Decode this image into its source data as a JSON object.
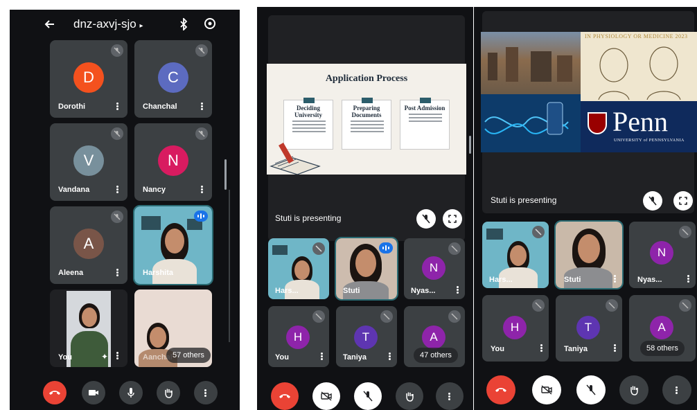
{
  "meeting": {
    "code": "dnz-axvj-sjo",
    "code_caret": "▸"
  },
  "colors": {
    "orange": "#f4511e",
    "indigo": "#5c6bc0",
    "slate": "#78909c",
    "crimson": "#d81b60",
    "brown": "#795548",
    "purple": "#8e24aa",
    "hangup": "#ea4335"
  },
  "screen1": {
    "tiles": [
      {
        "initial": "D",
        "name": "Dorothi"
      },
      {
        "initial": "C",
        "name": "Chanchal"
      },
      {
        "initial": "V",
        "name": "Vandana"
      },
      {
        "initial": "N",
        "name": "Nancy"
      },
      {
        "initial": "A",
        "name": "Aleena"
      },
      {
        "name": "Harshita"
      },
      {
        "name": "You"
      },
      {
        "name": "Aanchal"
      }
    ],
    "others": "57 others"
  },
  "screen2": {
    "presenting": "Stuti is presenting",
    "slide": {
      "title": "Application Process",
      "cards": [
        "Deciding University",
        "Preparing Documents",
        "Post Admission"
      ]
    },
    "tiles": [
      {
        "name": "Hars..."
      },
      {
        "name": "Stuti"
      },
      {
        "initial": "N",
        "name": "Nyas..."
      },
      {
        "initial": "H",
        "name": "You"
      },
      {
        "initial": "T",
        "name": "Taniya"
      },
      {
        "initial": "A",
        "name": "A"
      }
    ],
    "others": "47 others"
  },
  "screen3": {
    "presenting": "Stuti is presenting",
    "slide": {
      "banner": "IN PHYSIOLOGY OR MEDICINE 2023",
      "logo": "Penn",
      "logo_sub": "UNIVERSITY of PENNSYLVANIA"
    },
    "tiles": [
      {
        "name": "Hars..."
      },
      {
        "name": "Stuti"
      },
      {
        "initial": "N",
        "name": "Nyas..."
      },
      {
        "initial": "H",
        "name": "You"
      },
      {
        "initial": "T",
        "name": "Taniya"
      },
      {
        "initial": "A",
        "name": "A"
      }
    ],
    "others": "58 others"
  }
}
